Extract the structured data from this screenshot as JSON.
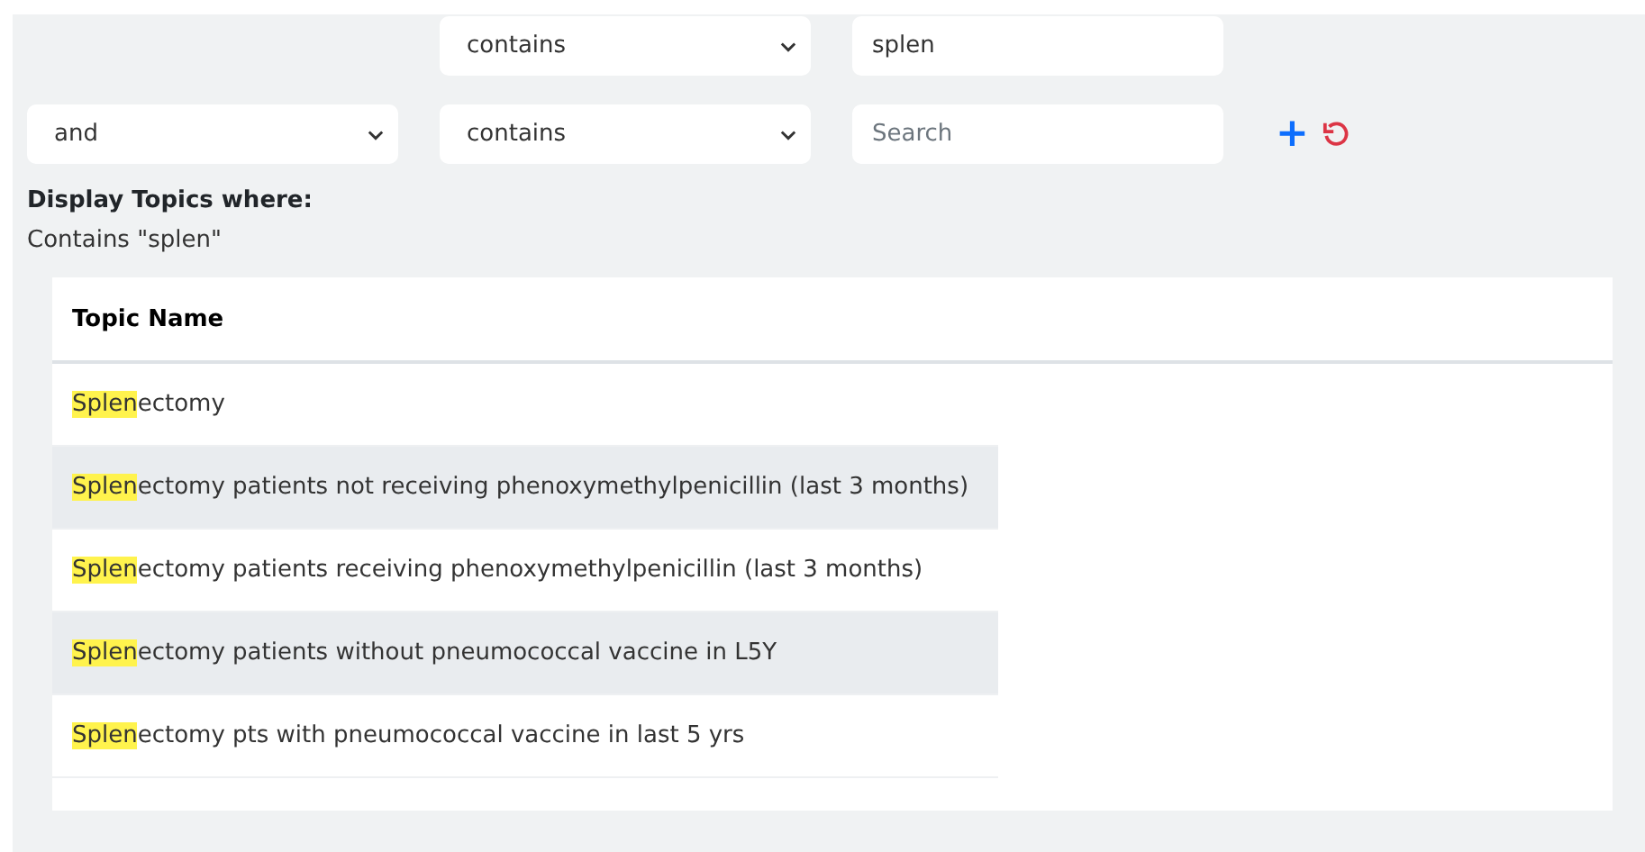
{
  "filters": [
    {
      "operator": "contains",
      "value": "splen"
    },
    {
      "conjunction": "and",
      "operator": "contains",
      "placeholder": "Search"
    }
  ],
  "actions": [
    {
      "kind": "add",
      "label": "+"
    },
    {
      "kind": "reset"
    }
  ],
  "summary": {
    "heading": "Display Topics where:",
    "text": "Contains \"splen\""
  },
  "table": {
    "columns": [
      "Topic Name"
    ],
    "rows": [
      {
        "match": "Splen",
        "rest": "ectomy"
      },
      {
        "match": "Splen",
        "rest": "ectomy patients not receiving phenoxymethylpenicillin (last 3 months)"
      },
      {
        "match": "Splen",
        "rest": "ectomy patients receiving phenoxymethylpenicillin (last 3 months)"
      },
      {
        "match": "Splen",
        "rest": "ectomy patients without pneumococcal vaccine in L5Y"
      },
      {
        "match": "Splen",
        "rest": "ectomy pts with pneumococcal vaccine in last 5 yrs"
      }
    ]
  }
}
